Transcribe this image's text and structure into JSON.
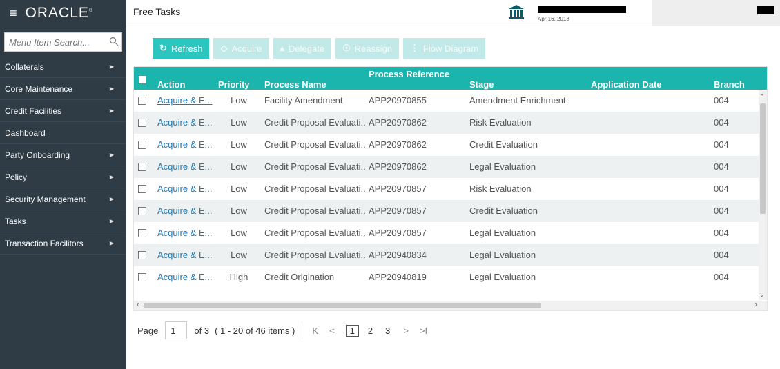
{
  "brand": {
    "logo": "ORACLE"
  },
  "header": {
    "title": "Free Tasks",
    "date": "Apr 16, 2018"
  },
  "sidebar": {
    "search_placeholder": "Menu Item Search...",
    "items": [
      {
        "label": "Collaterals",
        "has_submenu": true
      },
      {
        "label": "Core Maintenance",
        "has_submenu": true
      },
      {
        "label": "Credit Facilities",
        "has_submenu": true
      },
      {
        "label": "Dashboard",
        "has_submenu": false
      },
      {
        "label": "Party Onboarding",
        "has_submenu": true
      },
      {
        "label": "Policy",
        "has_submenu": true
      },
      {
        "label": "Security Management",
        "has_submenu": true
      },
      {
        "label": "Tasks",
        "has_submenu": true
      },
      {
        "label": "Transaction Facilitors",
        "has_submenu": true
      }
    ]
  },
  "toolbar": {
    "refresh": "Refresh",
    "acquire": "Acquire",
    "delegate": "Delegate",
    "reassign": "Reassign",
    "flow_diagram": "Flow Diagram"
  },
  "grid": {
    "columns": [
      "Action",
      "Priority",
      "Process Name",
      "Process Reference",
      "Stage",
      "Application Date",
      "Branch"
    ],
    "rows": [
      [
        "Acquire & E...",
        "Low",
        "Facility Amendment",
        "APP20970855",
        "Amendment Enrichment",
        "",
        "004"
      ],
      [
        "Acquire & E...",
        "Low",
        "Credit Proposal Evaluati...",
        "APP20970862",
        "Risk Evaluation",
        "",
        "004"
      ],
      [
        "Acquire & E...",
        "Low",
        "Credit Proposal Evaluati...",
        "APP20970862",
        "Credit Evaluation",
        "",
        "004"
      ],
      [
        "Acquire & E...",
        "Low",
        "Credit Proposal Evaluati...",
        "APP20970862",
        "Legal Evaluation",
        "",
        "004"
      ],
      [
        "Acquire & E...",
        "Low",
        "Credit Proposal Evaluati...",
        "APP20970857",
        "Risk Evaluation",
        "",
        "004"
      ],
      [
        "Acquire & E...",
        "Low",
        "Credit Proposal Evaluati...",
        "APP20970857",
        "Credit Evaluation",
        "",
        "004"
      ],
      [
        "Acquire & E...",
        "Low",
        "Credit Proposal Evaluati...",
        "APP20970857",
        "Legal Evaluation",
        "",
        "004"
      ],
      [
        "Acquire & E...",
        "Low",
        "Credit Proposal Evaluati...",
        "APP20940834",
        "Legal Evaluation",
        "",
        "004"
      ],
      [
        "Acquire & E...",
        "High",
        "Credit Origination",
        "APP20940819",
        "Legal Evaluation",
        "",
        "004"
      ]
    ]
  },
  "pager": {
    "page_label": "Page",
    "current_page": "1",
    "of_label": "of 3",
    "items_label": "( 1 - 20 of 46 items )",
    "pages": [
      "1",
      "2",
      "3"
    ],
    "first": "K",
    "prev": "<",
    "next": ">",
    "last": ">I"
  }
}
